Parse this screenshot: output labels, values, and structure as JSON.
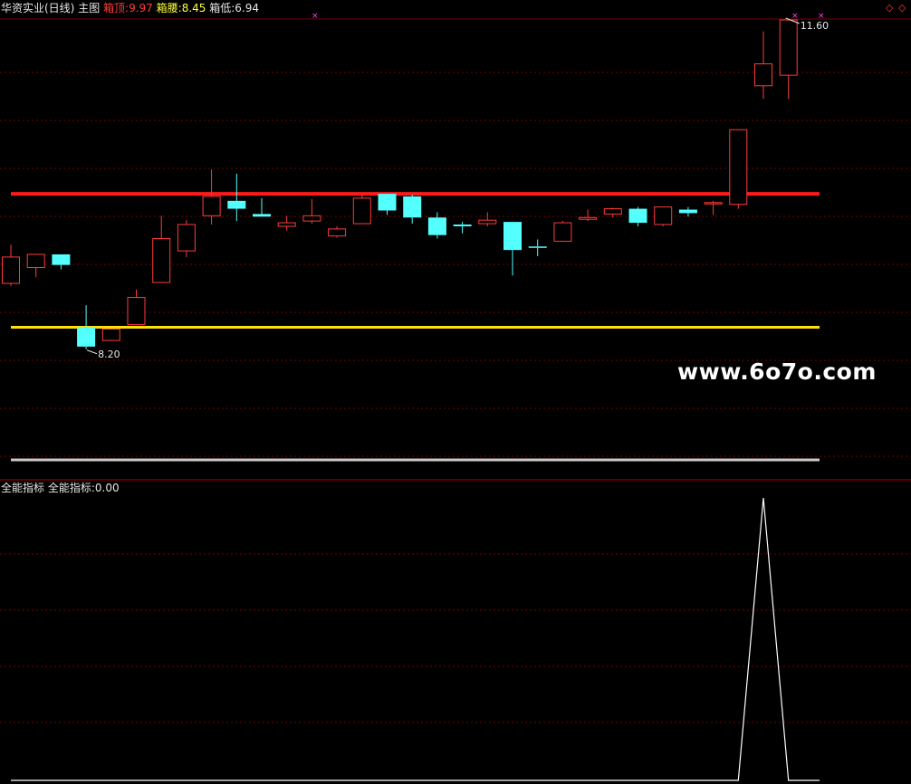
{
  "header": {
    "stock": "华资实业(日线)",
    "main_label": "主图",
    "top_label": "箱顶:",
    "top_value": "9.97",
    "mid_label": "箱腰:",
    "mid_value": "8.45",
    "low_label": "箱低:",
    "low_value": "6.94"
  },
  "lower_header": {
    "name": "全能指标",
    "series_label": "全能指标:",
    "value": "0.00"
  },
  "watermark": "www.6o7o.com",
  "colors": {
    "up": "#ff3b3b",
    "down": "#54ffff",
    "top_line": "#ff1a1a",
    "mid_line": "#ffe000",
    "low_line": "#c8c8c8",
    "grid": "#7a0000",
    "indicator": "#ffffff"
  },
  "chart_data": [
    {
      "type": "candlestick",
      "title": "华资实业(日线)",
      "ylim": [
        6.94,
        11.95
      ],
      "grid": true,
      "max_label": "11.60",
      "min_label": "8.20",
      "levels": [
        {
          "name": "箱顶",
          "value": 9.97
        },
        {
          "name": "箱腰",
          "value": 8.45
        },
        {
          "name": "箱低",
          "value": 6.94
        }
      ],
      "candles": [
        {
          "o": 8.95,
          "c": 9.25,
          "h": 9.39,
          "l": 8.92
        },
        {
          "o": 9.13,
          "c": 9.28,
          "h": 9.28,
          "l": 9.02
        },
        {
          "o": 9.28,
          "c": 9.16,
          "h": 9.28,
          "l": 9.11
        },
        {
          "o": 8.45,
          "c": 8.23,
          "h": 8.7,
          "l": 8.2
        },
        {
          "o": 8.3,
          "c": 8.43,
          "h": 8.43,
          "l": 8.3
        },
        {
          "o": 8.48,
          "c": 8.79,
          "h": 8.88,
          "l": 8.48
        },
        {
          "o": 8.96,
          "c": 9.46,
          "h": 9.72,
          "l": 8.96
        },
        {
          "o": 9.32,
          "c": 9.62,
          "h": 9.67,
          "l": 9.25
        },
        {
          "o": 9.72,
          "c": 9.94,
          "h": 10.25,
          "l": 9.62
        },
        {
          "o": 9.89,
          "c": 9.8,
          "h": 10.2,
          "l": 9.66
        },
        {
          "o": 9.74,
          "c": 9.71,
          "h": 9.92,
          "l": 9.71
        },
        {
          "o": 9.6,
          "c": 9.64,
          "h": 9.72,
          "l": 9.55
        },
        {
          "o": 9.66,
          "c": 9.72,
          "h": 9.91,
          "l": 9.63
        },
        {
          "o": 9.49,
          "c": 9.57,
          "h": 9.6,
          "l": 9.47
        },
        {
          "o": 9.63,
          "c": 9.92,
          "h": 9.96,
          "l": 9.63
        },
        {
          "o": 9.97,
          "c": 9.78,
          "h": 9.97,
          "l": 9.73
        },
        {
          "o": 9.94,
          "c": 9.7,
          "h": 9.96,
          "l": 9.63
        },
        {
          "o": 9.7,
          "c": 9.5,
          "h": 9.76,
          "l": 9.46
        },
        {
          "o": 9.62,
          "c": 9.6,
          "h": 9.65,
          "l": 9.52
        },
        {
          "o": 9.63,
          "c": 9.67,
          "h": 9.76,
          "l": 9.6
        },
        {
          "o": 9.65,
          "c": 9.33,
          "h": 9.65,
          "l": 9.04
        },
        {
          "o": 9.37,
          "c": 9.36,
          "h": 9.45,
          "l": 9.26
        },
        {
          "o": 9.43,
          "c": 9.64,
          "h": 9.66,
          "l": 9.43
        },
        {
          "o": 9.68,
          "c": 9.7,
          "h": 9.79,
          "l": 9.66
        },
        {
          "o": 9.74,
          "c": 9.8,
          "h": 9.81,
          "l": 9.7
        },
        {
          "o": 9.8,
          "c": 9.64,
          "h": 9.82,
          "l": 9.6
        },
        {
          "o": 9.62,
          "c": 9.82,
          "h": 9.82,
          "l": 9.6
        },
        {
          "o": 9.79,
          "c": 9.75,
          "h": 9.82,
          "l": 9.71
        },
        {
          "o": 9.87,
          "c": 9.87,
          "h": 9.89,
          "l": 9.73
        },
        {
          "o": 9.85,
          "c": 10.7,
          "h": 10.7,
          "l": 9.8
        },
        {
          "o": 11.2,
          "c": 11.45,
          "h": 11.82,
          "l": 11.05
        },
        {
          "o": 11.32,
          "c": 11.95,
          "h": 11.95,
          "l": 11.05
        }
      ]
    },
    {
      "type": "line",
      "title": "全能指标",
      "ylim": [
        0,
        1
      ],
      "grid": true,
      "series": [
        {
          "name": "全能指标",
          "values": [
            0,
            0,
            0,
            0,
            0,
            0,
            0,
            0,
            0,
            0,
            0,
            0,
            0,
            0,
            0,
            0,
            0,
            0,
            0,
            0,
            0,
            0,
            0,
            0,
            0,
            0,
            0,
            0,
            0,
            0,
            1,
            0
          ]
        }
      ]
    }
  ]
}
